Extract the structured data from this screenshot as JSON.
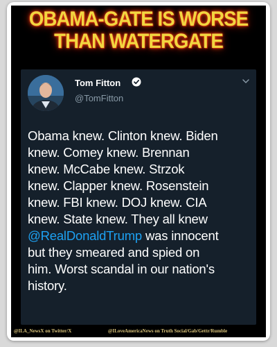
{
  "headline": {
    "line1": "OBAMA-GATE IS WORSE",
    "line2": "THAN WATERGATE"
  },
  "tweet": {
    "author_name": "Tom Fitton",
    "author_handle": "@TomFitton",
    "verified_icon": "verified-badge-icon",
    "menu_icon": "chevron-down-icon",
    "lines": [
      "Obama knew. Clinton knew. Biden",
      "knew. Comey knew. Brennan",
      "knew. McCabe knew. Strzok",
      "knew. Clapper knew. Rosenstein",
      "knew. FBI knew. DOJ knew. CIA",
      "knew. State knew. They all knew"
    ],
    "mention": "@RealDonaldTrump",
    "after_mention": " was innocent",
    "lines_after": [
      "but they smeared and spied on",
      "him. Worst scandal in our nation's",
      "history."
    ],
    "mention_color": "#1da1f2",
    "background_color": "#15202b"
  },
  "footer": {
    "left": "@ILA_NewsX on Twitter/X",
    "right": "@ILoveAmericaNews on Truth Social/Gab/Gettr/Rumble"
  },
  "colors": {
    "headline": "#f2d640",
    "headline_glow": "#e23a1a"
  }
}
